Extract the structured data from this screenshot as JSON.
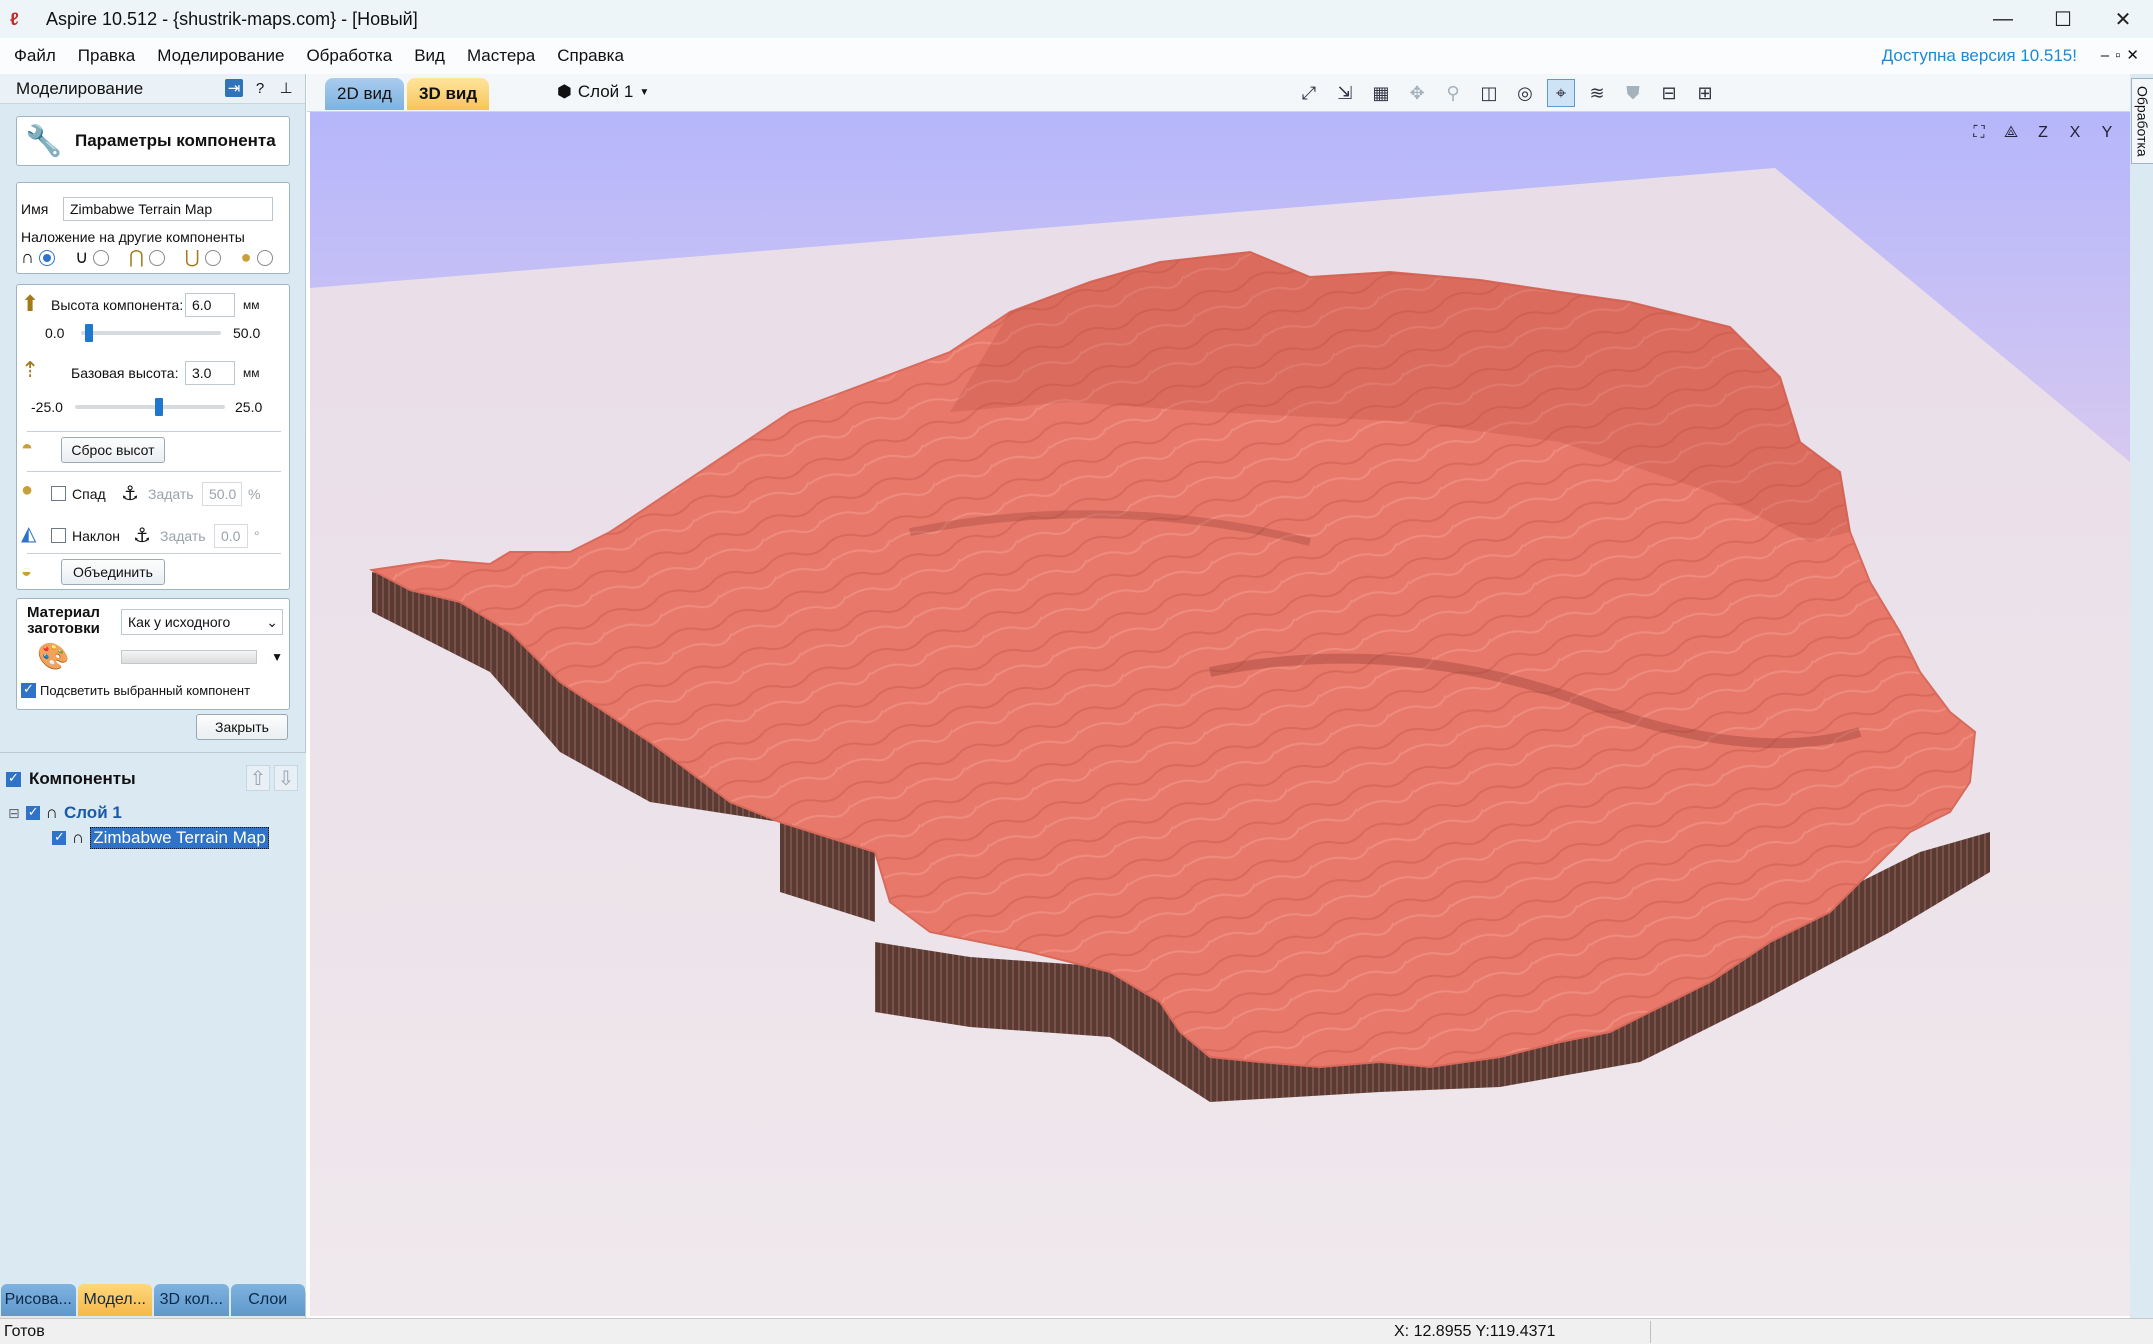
{
  "window": {
    "title": "Aspire 10.512 - {shustrik-maps.com} - [Новый]",
    "controls": {
      "minimize": "—",
      "maximize": "☐",
      "close": "✕"
    }
  },
  "menu": {
    "items": [
      "Файл",
      "Правка",
      "Моделирование",
      "Обработка",
      "Вид",
      "Мастера",
      "Справка"
    ],
    "update_notice": "Доступна версия 10.515!",
    "mdi_controls": "–▫✕"
  },
  "left_panel": {
    "header": "Моделирование",
    "header_icons": {
      "pin": "⇥",
      "help": "?",
      "unpin": "⊥"
    },
    "component_params_title": "Параметры компонента",
    "name_label": "Имя",
    "name_value": "Zimbabwe Terrain Map",
    "overlay_label": "Наложение на другие компоненты",
    "overlay_modes": [
      "add",
      "subtract",
      "merge-high",
      "merge-low"
    ],
    "overlay_selected_index": 0,
    "component_height": {
      "label": "Высота компонента:",
      "value": "6.0",
      "unit": "мм",
      "min": "0.0",
      "max": "50.0",
      "position": 0.06
    },
    "base_height": {
      "label": "Базовая высота:",
      "value": "3.0",
      "unit": "мм",
      "min": "-25.0",
      "max": "25.0",
      "position": 0.56
    },
    "reset_heights_button": "Сброс высот",
    "fade": {
      "label": "Спад",
      "checked": false,
      "set_label": "Задать",
      "value": "50.0",
      "unit": "%"
    },
    "tilt": {
      "label": "Наклон",
      "checked": false,
      "set_label": "Задать",
      "value": "0.0",
      "unit": "°"
    },
    "combine_button": "Объединить",
    "material": {
      "label_line1": "Материал",
      "label_line2": "заготовки",
      "select_value": "Как у исходного",
      "color_select_value": ""
    },
    "highlight_selected": {
      "label": "Подсветить выбранный компонент",
      "checked": true
    },
    "close_button": "Закрыть"
  },
  "components_tree": {
    "title": "Компоненты",
    "layer": {
      "label": "Слой 1",
      "checked": true,
      "expander": "⊟"
    },
    "items": [
      {
        "label": "Zimbabwe Terrain Map",
        "checked": true,
        "selected": true
      }
    ]
  },
  "bottom_tabs": [
    {
      "label": "Рисова...",
      "active": false
    },
    {
      "label": "Модел...",
      "active": true
    },
    {
      "label": "3D кол...",
      "active": false
    },
    {
      "label": "Слои",
      "active": false
    }
  ],
  "view_tabs": {
    "tab_2d": "2D вид",
    "tab_3d": "3D вид",
    "layer_selector": "Слой 1"
  },
  "toolbar_icons": [
    {
      "name": "node-edit-icon",
      "glyph": "⤢",
      "state": "normal"
    },
    {
      "name": "transform-icon",
      "glyph": "⇲",
      "state": "normal"
    },
    {
      "name": "grid-icon",
      "glyph": "▦",
      "state": "normal"
    },
    {
      "name": "pan-icon",
      "glyph": "✥",
      "state": "dim"
    },
    {
      "name": "zoom-icon",
      "glyph": "⚲",
      "state": "dim"
    },
    {
      "name": "zoom-box-icon",
      "glyph": "◫",
      "state": "normal"
    },
    {
      "name": "zoom-extents-icon",
      "glyph": "◎",
      "state": "normal"
    },
    {
      "name": "select-vectors-icon",
      "glyph": "⌖",
      "state": "sel"
    },
    {
      "name": "toolpath-icon",
      "glyph": "≋",
      "state": "normal"
    },
    {
      "name": "shade-icon",
      "glyph": "⛊",
      "state": "dim"
    },
    {
      "name": "split-horizontal-icon",
      "glyph": "⊟",
      "state": "normal"
    },
    {
      "name": "split-vertical-icon",
      "glyph": "⊞",
      "state": "normal"
    }
  ],
  "viewport_icons": [
    {
      "name": "fit-view-icon",
      "glyph": "⛶"
    },
    {
      "name": "iso-view-icon",
      "glyph": "⟁"
    },
    {
      "name": "view-z-icon",
      "glyph": "Z"
    },
    {
      "name": "view-x-icon",
      "glyph": "X"
    },
    {
      "name": "view-y-icon",
      "glyph": "Y"
    }
  ],
  "right_strip_tab": "Обработка",
  "colors": {
    "terrain": "#e8796a",
    "terrain_side": "#5a3b34",
    "accent": "#2f73c8"
  },
  "status": {
    "ready": "Готов",
    "coords": "X: 12.8955 Y:119.4371"
  }
}
